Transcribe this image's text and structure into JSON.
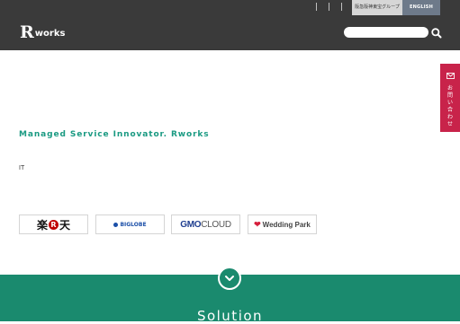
{
  "topbar": {
    "group_label": "阪急阪神東宝グループ",
    "english_label": "ENGLISH"
  },
  "header": {
    "logo_r": "R",
    "logo_rest": "works",
    "search_placeholder": ""
  },
  "contact": {
    "label": "お問い合わせ"
  },
  "hero": {
    "tagline": "Managed Service Innovator. Rworks",
    "description": "IT"
  },
  "partners": [
    {
      "name": "楽天",
      "left": "楽",
      "mid": "R",
      "right": "天"
    },
    {
      "name": "BIGLOBE",
      "label": "BIGLOBE"
    },
    {
      "name": "GMO CLOUD",
      "gmo": "GMO",
      "cloud": "CLOUD"
    },
    {
      "name": "Wedding Park",
      "label": "Wedding Park"
    }
  ],
  "section": {
    "title": "Solution"
  },
  "colors": {
    "header_bg": "#3a3a3a",
    "accent_green": "#1a8a6e",
    "tagline_green": "#1a9a82",
    "contact_red": "#c8234a"
  }
}
